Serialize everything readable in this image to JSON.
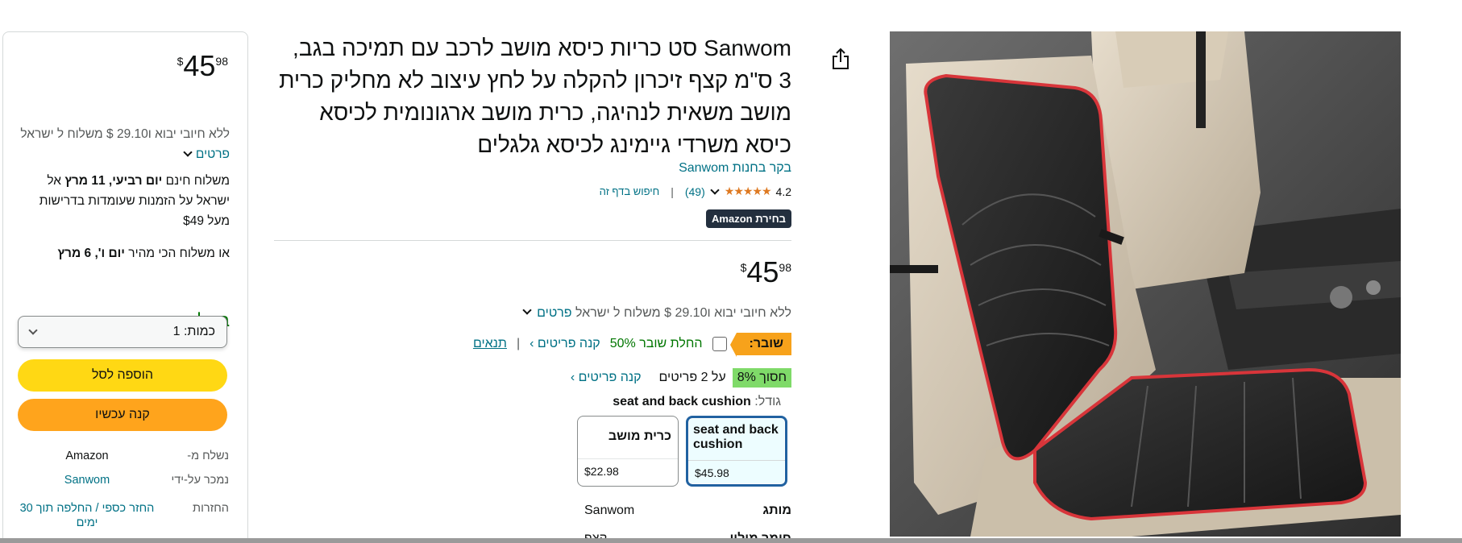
{
  "buybox": {
    "price": {
      "symbol": "$",
      "whole": "45",
      "fraction": "98"
    },
    "import_fee": "ללא חיובי יבוא ו29.10 $ משלוח ל ישראל",
    "details_link": "פרטים",
    "delivery_pre": "משלוח חינם ",
    "delivery_date": "יום רביעי, 11 מרץ",
    "delivery_post": " אל ישראל על הזמנות שעומדות בדרישות מעל $49",
    "fast_pre": "או משלוח הכי מהיר ",
    "fast_date": "יום ו', 6 מרץ",
    "stock": "במלאי",
    "quantity_label": "כמות: 1",
    "add_to_cart": "הוספה לסל",
    "buy_now": "קנה עכשיו",
    "ships_from_label": "נשלח מ-",
    "ships_from_value": "Amazon",
    "sold_by_label": "נמכר על-ידי",
    "sold_by_value": "Sanwom",
    "returns_label": "החזרות",
    "returns_value": "החזר כספי / החלפה תוך 30 ימים"
  },
  "product": {
    "title": "Sanwom סט כריות כיסא מושב לרכב עם תמיכה בגב, 3 ס\"מ קצף זיכרון להקלה על לחץ עיצוב לא מחליק כרית מושב משאית לנהיגה, כרית מושב ארגונומית לכיסא כיסא משרדי גיימינג לכיסא גלגלים",
    "store_link": "בקר בחנות Sanwom",
    "rating": "4.2",
    "stars": "★★★★★",
    "review_count": "(49)",
    "search_page": "חיפוש בדף זה",
    "badge": "בחירת Amazon",
    "price": {
      "symbol": "$",
      "whole": "45",
      "fraction": "98"
    },
    "import_fee": "ללא חיובי יבוא ו29.10 $ משלוח ל ישראל",
    "details_link": "פרטים",
    "coupon_label": "שובר:",
    "coupon_apply": "החלת שובר 50%",
    "coupon_buy": "קנה פריטים ›",
    "coupon_terms": "תנאים",
    "save_badge": "חסוך 8%",
    "save_text": "על 2 פריטים",
    "save_buy": "קנה פריטים ›",
    "size_label": "גודל:",
    "size_value": "seat and back cushion",
    "swatches": [
      {
        "name": "seat and back cushion",
        "price": "$45.98"
      },
      {
        "name": "כרית מושב",
        "price": "$22.98"
      }
    ],
    "brand_label": "מותג",
    "brand_value": "Sanwom",
    "cut_label": "חומר מילוי",
    "cut_value": "קצף"
  },
  "colors": {
    "link": "#007185",
    "add_to_cart": "#ffd814",
    "buy_now": "#ffa41c",
    "in_stock": "#007600",
    "stars": "#de7921",
    "selected_swatch": "#2162a1"
  },
  "icons": {
    "share": "share-icon",
    "chevron": "chevron-down-icon"
  }
}
